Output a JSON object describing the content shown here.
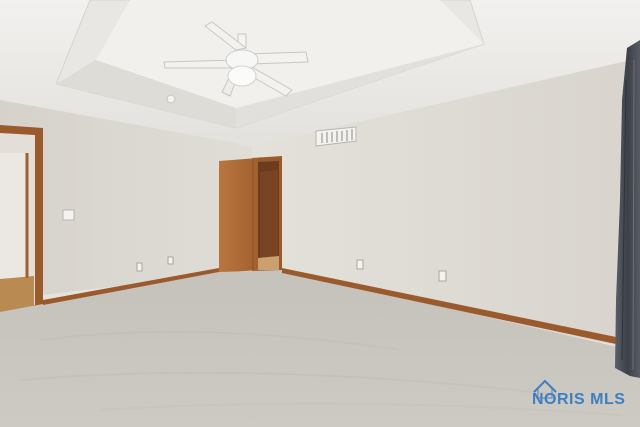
{
  "watermark": {
    "text": "NORIS MLS",
    "icon": "house-roof-icon",
    "color": "#3f7fc0"
  },
  "palette": {
    "wall": "#dedad4",
    "ceiling": "#ecebe8",
    "carpet": "#c9c5bf",
    "door": "#b06a35",
    "baseboard": "#9a5a2c",
    "curtain": "#4a4f57"
  }
}
